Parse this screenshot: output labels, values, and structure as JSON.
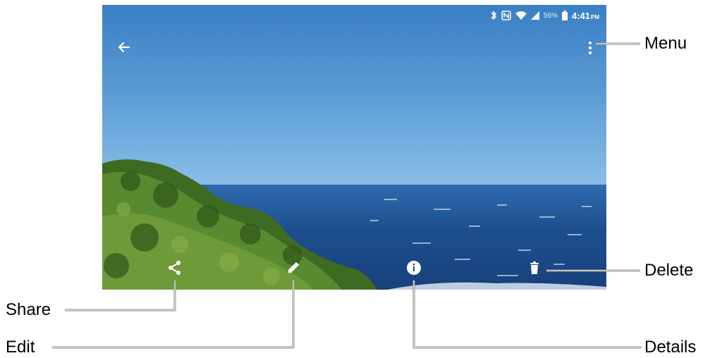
{
  "status_bar": {
    "battery_percent": "56%",
    "time": "4:41",
    "ampm": "PM",
    "icons": [
      "bluetooth-icon",
      "nfc-icon",
      "wifi-icon",
      "signal-icon",
      "battery-icon"
    ]
  },
  "toolbar": {
    "back_icon": "arrow-left-icon",
    "menu_icon": "more-vertical-icon"
  },
  "actions": [
    {
      "name": "share",
      "icon": "share-icon"
    },
    {
      "name": "edit",
      "icon": "pencil-icon"
    },
    {
      "name": "details",
      "icon": "info-icon"
    },
    {
      "name": "delete",
      "icon": "trash-icon"
    }
  ],
  "callouts": {
    "menu": "Menu",
    "delete": "Delete",
    "share": "Share",
    "edit": "Edit",
    "details": "Details"
  },
  "colors": {
    "sky": "#6aa8dc",
    "sea": "#1d4f8e",
    "foliage": "#4e7d2a",
    "callout_line": "#888888"
  }
}
